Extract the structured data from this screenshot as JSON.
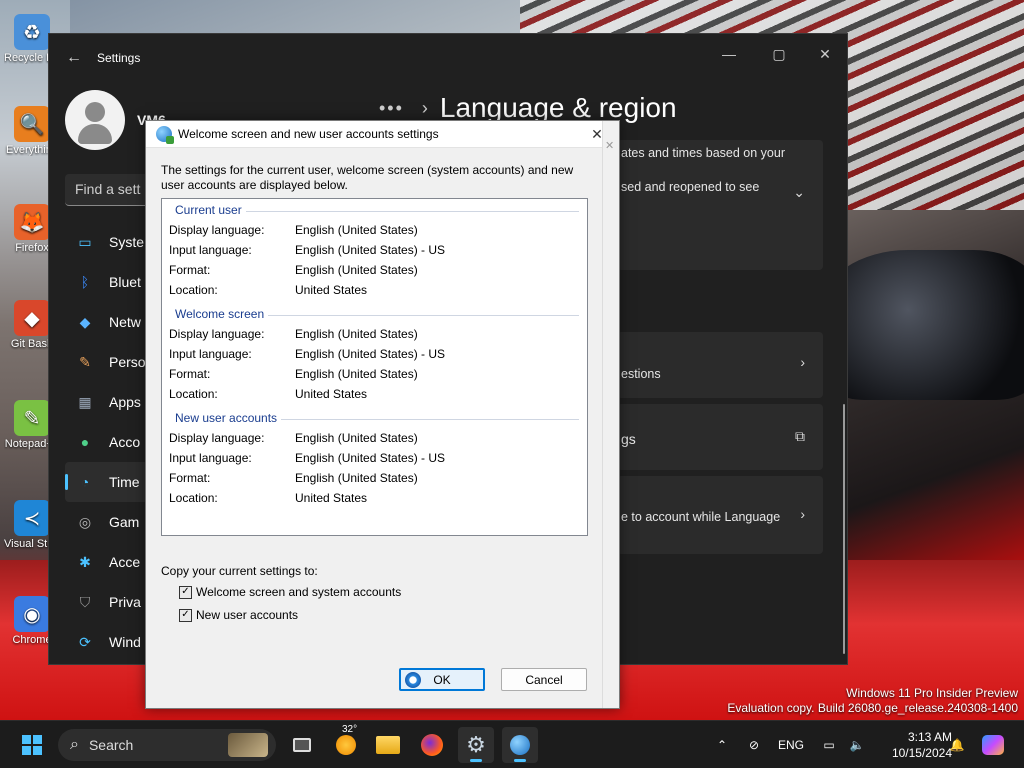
{
  "desktop": {
    "icons": [
      {
        "label": "Recycle Bin",
        "glyph": "♻",
        "icon": "recycle-bin-icon",
        "color": "#4a90d9"
      },
      {
        "label": "Everything",
        "glyph": "🔍",
        "icon": "everything-search-icon",
        "color": "#e87e1e"
      },
      {
        "label": "Firefox",
        "glyph": "🦊",
        "icon": "firefox-icon",
        "color": "#e8622a"
      },
      {
        "label": "Git Bash",
        "glyph": "◆",
        "icon": "git-bash-icon",
        "color": "#d9472b"
      },
      {
        "label": "Notepad++",
        "glyph": "✎",
        "icon": "notepadpp-icon",
        "color": "#7ac143"
      },
      {
        "label": "Visual Studio Code",
        "glyph": "≺",
        "icon": "vscode-icon",
        "color": "#1f86d6"
      },
      {
        "label": "Chrome",
        "glyph": "◉",
        "icon": "chrome-icon",
        "color": "#3a7be0"
      }
    ],
    "watermark_line1": "Windows 11 Pro Insider Preview",
    "watermark_line2": "Evaluation copy. Build 26080.ge_release.240308-1400"
  },
  "settings": {
    "title": "Settings",
    "user_name": "VM6",
    "find_placeholder": "Find a sett",
    "page_title": "Language & region",
    "breadcrumb_dots": "•••",
    "nav": [
      {
        "label": "Syste",
        "icon": "system-icon",
        "glyph": "▭",
        "color": "#4cc2ff"
      },
      {
        "label": "Bluet",
        "icon": "bluetooth-icon",
        "glyph": "ᛒ",
        "color": "#3b8cff"
      },
      {
        "label": "Netw",
        "icon": "network-icon",
        "glyph": "◆",
        "color": "#5ab4ff"
      },
      {
        "label": "Perso",
        "icon": "personalization-icon",
        "glyph": "✎",
        "color": "#e8a15b"
      },
      {
        "label": "Apps",
        "icon": "apps-icon",
        "glyph": "▦",
        "color": "#9aa7b8"
      },
      {
        "label": "Acco",
        "icon": "accounts-icon",
        "glyph": "●",
        "color": "#4fd08a"
      },
      {
        "label": "Time",
        "icon": "time-language-icon",
        "glyph": "◔",
        "color": "#4cc2ff"
      },
      {
        "label": "Gam",
        "icon": "gaming-icon",
        "glyph": "◎",
        "color": "#b8b8b8"
      },
      {
        "label": "Acce",
        "icon": "accessibility-icon",
        "glyph": "✱",
        "color": "#4cc2ff"
      },
      {
        "label": "Priva",
        "icon": "privacy-shield-icon",
        "glyph": "⛉",
        "color": "#9a9a9a"
      },
      {
        "label": "Wind",
        "icon": "windows-update-icon",
        "glyph": "⟳",
        "color": "#4cc2ff"
      }
    ],
    "cards": [
      {
        "line1": "ates and times based on your",
        "line2": "",
        "icon": "chevron-down-icon",
        "glyph": "⌄"
      },
      {
        "line1": "sed and reopened to see",
        "line2": "",
        "icon": "",
        "glyph": ""
      },
      {
        "line1": "estions",
        "line2": "",
        "icon": "chevron-right-icon",
        "glyph": "›"
      },
      {
        "line1": "gs",
        "line2": "",
        "icon": "open-external-icon",
        "glyph": "⧉"
      },
      {
        "line1": "e to account while Language",
        "line2": "",
        "icon": "chevron-right-icon",
        "glyph": "›"
      }
    ]
  },
  "dialog": {
    "title": "Welcome screen and new user accounts settings",
    "intro": "The settings for the current user, welcome screen (system accounts) and new user accounts are displayed below.",
    "groups": [
      {
        "header": "Current user",
        "rows": [
          {
            "key": "Display language:",
            "value": "English (United States)"
          },
          {
            "key": "Input language:",
            "value": "English (United States) - US"
          },
          {
            "key": "Format:",
            "value": "English (United States)"
          },
          {
            "key": "Location:",
            "value": "United States"
          }
        ]
      },
      {
        "header": "Welcome screen",
        "rows": [
          {
            "key": "Display language:",
            "value": "English (United States)"
          },
          {
            "key": "Input language:",
            "value": "English (United States) - US"
          },
          {
            "key": "Format:",
            "value": "English (United States)"
          },
          {
            "key": "Location:",
            "value": "United States"
          }
        ]
      },
      {
        "header": "New user accounts",
        "rows": [
          {
            "key": "Display language:",
            "value": "English (United States)"
          },
          {
            "key": "Input language:",
            "value": "English (United States) - US"
          },
          {
            "key": "Format:",
            "value": "English (United States)"
          },
          {
            "key": "Location:",
            "value": "United States"
          }
        ]
      }
    ],
    "copy_label": "Copy your current settings to:",
    "checkboxes": [
      {
        "label": "Welcome screen and system accounts",
        "checked": true
      },
      {
        "label": "New user accounts",
        "checked": true
      }
    ],
    "ok_label": "OK",
    "cancel_label": "Cancel"
  },
  "taskbar": {
    "search_label": "Search",
    "weather_temp": "32°",
    "language": "ENG",
    "time": "3:13 AM",
    "date": "10/15/2024",
    "accent": "#4cc2ff"
  }
}
